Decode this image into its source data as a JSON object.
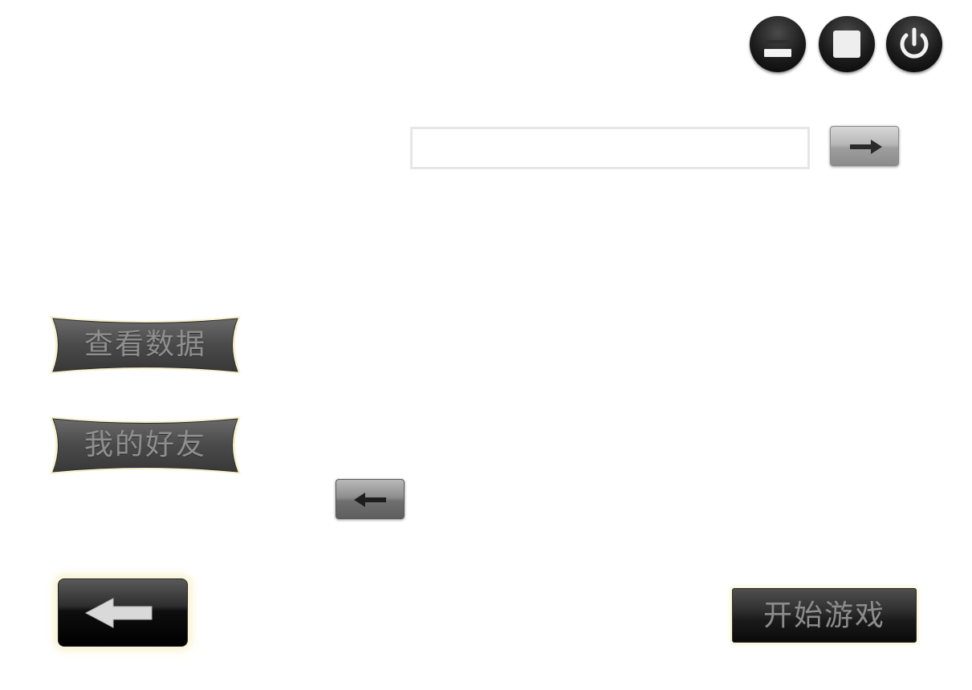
{
  "window_controls": {
    "minimize": {
      "icon": "minimize-icon"
    },
    "maximize": {
      "icon": "maximize-icon"
    },
    "power": {
      "icon": "power-icon"
    }
  },
  "search": {
    "value": "",
    "placeholder": "",
    "submit_icon": "arrow-right-icon"
  },
  "menu": {
    "view_data_label": "查看数据",
    "my_friends_label": "我的好友"
  },
  "nav": {
    "small_back_icon": "arrow-left-icon",
    "big_back_icon": "arrow-left-icon"
  },
  "start": {
    "label": "开始游戏"
  },
  "colors": {
    "button_dark": "#1c1c1c",
    "button_text": "#8f8f8f",
    "glow": "#f5ebb4",
    "input_border": "#e6e6e6"
  }
}
